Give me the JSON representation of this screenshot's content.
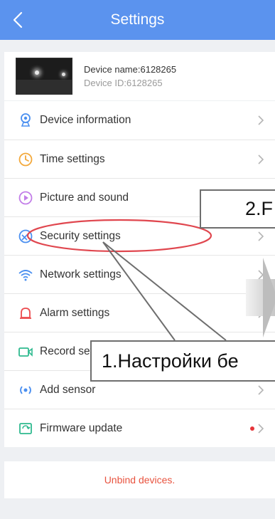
{
  "header": {
    "title": "Settings"
  },
  "device": {
    "name": "Device name:6128265",
    "id": "Device ID:6128265"
  },
  "menu": {
    "items": [
      {
        "label": "Device information",
        "icon": "device-info-icon",
        "color": "#4a8ff0"
      },
      {
        "label": "Time settings",
        "icon": "clock-icon",
        "color": "#f3a83a"
      },
      {
        "label": "Picture and sound",
        "icon": "media-icon",
        "color": "#c27de8"
      },
      {
        "label": "Security settings",
        "icon": "shield-icon",
        "color": "#4a8ff0"
      },
      {
        "label": "Network settings",
        "icon": "wifi-icon",
        "color": "#4a8ff0"
      },
      {
        "label": "Alarm settings",
        "icon": "alarm-icon",
        "color": "#ec4b4f"
      },
      {
        "label": "Record set",
        "icon": "record-icon",
        "color": "#2fba8f"
      },
      {
        "label": "Add sensor",
        "icon": "sensor-icon",
        "color": "#4a8ff0"
      },
      {
        "label": "Firmware update",
        "icon": "firmware-icon",
        "color": "#2fba8f",
        "badge": true
      }
    ]
  },
  "footer": {
    "unbind_label": "Unbind devices."
  },
  "annotations": {
    "callout_1": "1.Настройки бе",
    "callout_2": "2.F"
  },
  "colors": {
    "header": "#5b93ee",
    "accent": "#4a8ff0",
    "danger": "#e8533f",
    "annotation": "#e0474f"
  }
}
